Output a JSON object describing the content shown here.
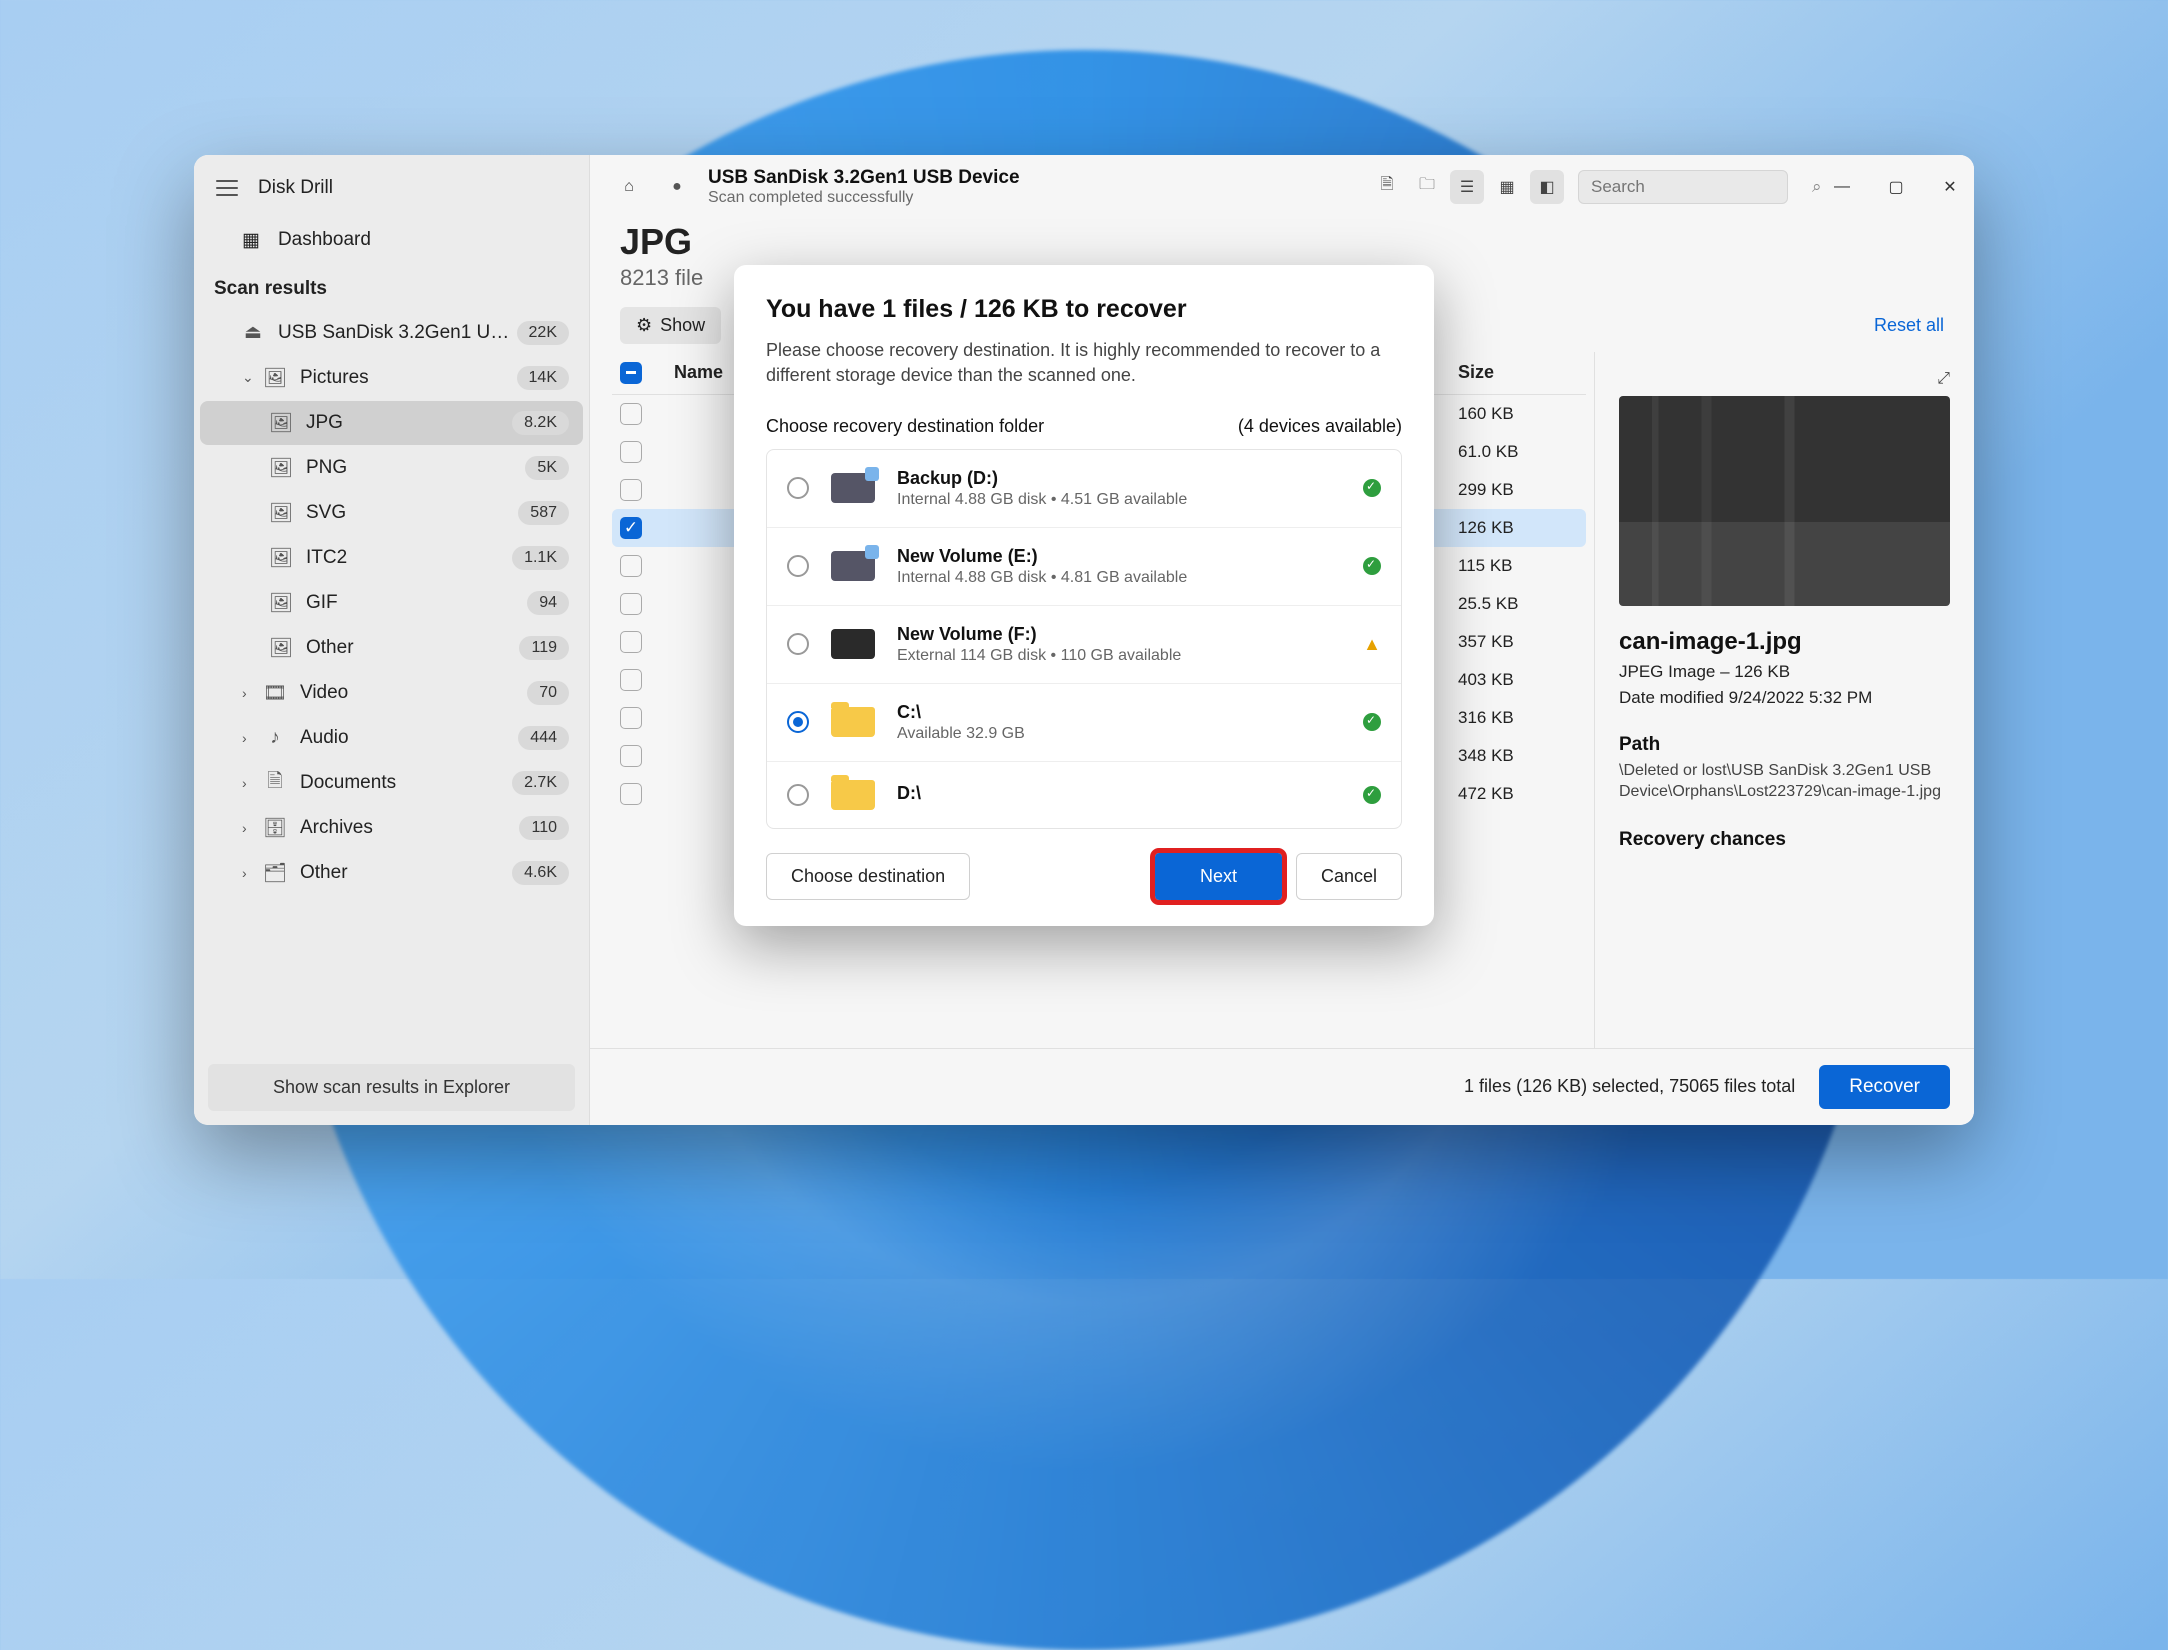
{
  "app": {
    "title": "Disk Drill"
  },
  "sidebar": {
    "dashboard": "Dashboard",
    "section": "Scan results",
    "device": {
      "label": "USB  SanDisk 3.2Gen1 U…",
      "count": "22K"
    },
    "pictures": {
      "label": "Pictures",
      "count": "14K",
      "expanded": true,
      "children": [
        {
          "label": "JPG",
          "count": "8.2K",
          "active": true
        },
        {
          "label": "PNG",
          "count": "5K"
        },
        {
          "label": "SVG",
          "count": "587"
        },
        {
          "label": "ITC2",
          "count": "1.1K"
        },
        {
          "label": "GIF",
          "count": "94"
        },
        {
          "label": "Other",
          "count": "119"
        }
      ]
    },
    "others": [
      {
        "label": "Video",
        "count": "70"
      },
      {
        "label": "Audio",
        "count": "444"
      },
      {
        "label": "Documents",
        "count": "2.7K"
      },
      {
        "label": "Archives",
        "count": "110"
      },
      {
        "label": "Other",
        "count": "4.6K"
      }
    ],
    "show_explorer": "Show scan results in Explorer"
  },
  "header": {
    "device": "USB  SanDisk 3.2Gen1 USB Device",
    "status": "Scan completed successfully",
    "search_placeholder": "Search"
  },
  "page": {
    "title": "JPG",
    "subtitle": "8213 file",
    "show_filter": "Show",
    "reset_all": "Reset all"
  },
  "table": {
    "columns": {
      "name": "Name",
      "size": "Size"
    },
    "rows": [
      {
        "size": "160 KB"
      },
      {
        "size": "61.0 KB"
      },
      {
        "size": "299 KB"
      },
      {
        "size": "126 KB",
        "selected": true
      },
      {
        "size": "115 KB"
      },
      {
        "size": "25.5 KB"
      },
      {
        "size": "357 KB"
      },
      {
        "size": "403 KB"
      },
      {
        "size": "316 KB"
      },
      {
        "size": "348 KB"
      },
      {
        "size": "472 KB"
      }
    ]
  },
  "details": {
    "filename": "can-image-1.jpg",
    "type_line": "JPEG Image – 126 KB",
    "modified": "Date modified 9/24/2022 5:32 PM",
    "path_label": "Path",
    "path_value": "\\Deleted or lost\\USB  SanDisk 3.2Gen1 USB Device\\Orphans\\Lost223729\\can-image-1.jpg",
    "recovery_label": "Recovery chances"
  },
  "footer": {
    "status": "1 files (126 KB) selected, 75065 files total",
    "recover": "Recover"
  },
  "modal": {
    "title": "You have 1 files / 126 KB to recover",
    "body": "Please choose recovery destination. It is highly recommended to recover to a different storage device than the scanned one.",
    "choose_label": "Choose recovery destination folder",
    "devices_label": "(4 devices available)",
    "destinations": [
      {
        "name": "Backup (D:)",
        "sub": "Internal 4.88 GB disk • 4.51 GB available",
        "icon": "disk",
        "status": "ok"
      },
      {
        "name": "New Volume (E:)",
        "sub": "Internal 4.88 GB disk • 4.81 GB available",
        "icon": "disk",
        "status": "ok"
      },
      {
        "name": "New Volume (F:)",
        "sub": "External 114 GB disk • 110 GB available",
        "icon": "ext",
        "status": "warn"
      },
      {
        "name": "C:\\",
        "sub": "Available 32.9 GB",
        "icon": "folder",
        "status": "ok",
        "selected": true
      },
      {
        "name": "D:\\",
        "sub": "",
        "icon": "folder",
        "status": "ok"
      }
    ],
    "choose_btn": "Choose destination",
    "next_btn": "Next",
    "cancel_btn": "Cancel"
  }
}
